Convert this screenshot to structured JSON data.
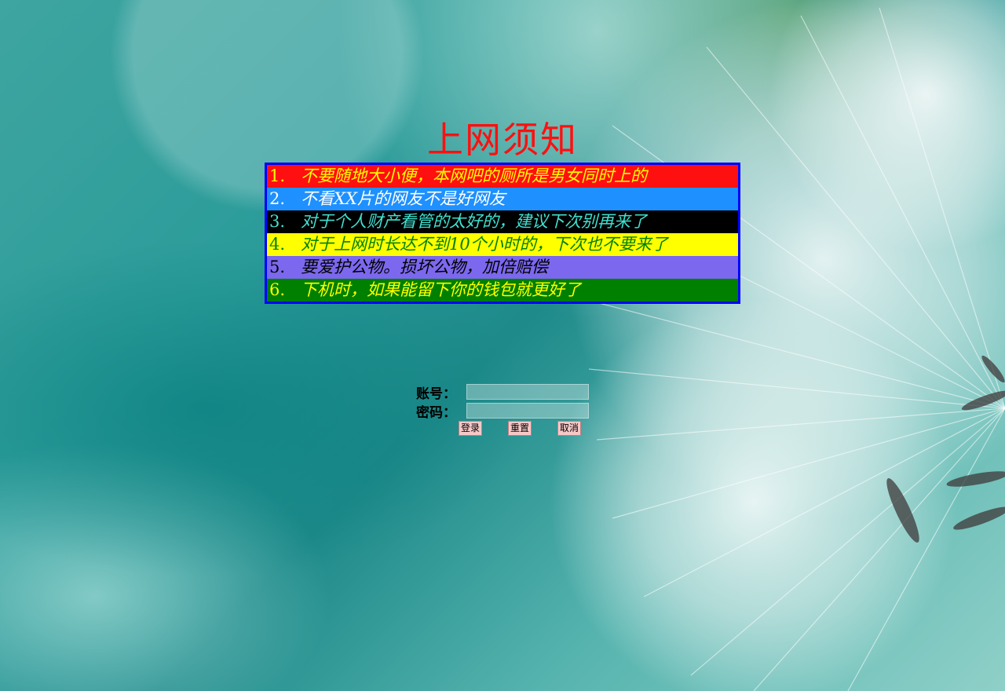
{
  "page": {
    "title": "上网须知",
    "title_color": "#ff1010",
    "border_color": "#0000ff"
  },
  "rules": [
    {
      "num": "1.",
      "text": "不要随地大小便，本网吧的厕所是男女同时上的",
      "bg": "#ff1010",
      "color": "#ffff00"
    },
    {
      "num": "2.",
      "text": "不看XX片的网友不是好网友",
      "bg": "#1e90ff",
      "color": "#ffffff"
    },
    {
      "num": "3.",
      "text": "对于个人财产看管的太好的，建议下次别再来了",
      "bg": "#000000",
      "color": "#40e0d0"
    },
    {
      "num": "4.",
      "text": "对于上网时长达不到10个小时的，下次也不要来了",
      "bg": "#ffff00",
      "color": "#008000"
    },
    {
      "num": "5.",
      "text": "要爱护公物。损坏公物，加倍赔偿",
      "bg": "#7b68ee",
      "color": "#000000"
    },
    {
      "num": "6.",
      "text": "下机时，如果能留下你的钱包就更好了",
      "bg": "#008000",
      "color": "#ffff00"
    }
  ],
  "login": {
    "account_label": "账号：",
    "account_value": "",
    "password_label": "密码：",
    "password_value": "",
    "buttons": {
      "login": "登录",
      "reset": "重置",
      "cancel": "取消"
    }
  }
}
